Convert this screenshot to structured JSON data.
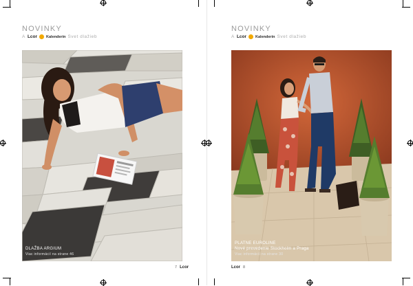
{
  "left_page": {
    "title": "NOVINKY",
    "subtitle_prefix": "A",
    "brand_name": "Lcor",
    "brand_secondary": "Kalenderin",
    "subtitle_suffix": "Svet dlažieb",
    "caption_title": "DLAŽBA ARGIUM",
    "caption_sub": "Viac informácií na strane 46",
    "page_number": "7",
    "footer_brand": "Lcor"
  },
  "right_page": {
    "title": "NOVINKY",
    "subtitle_prefix": "A",
    "brand_name": "Lcor",
    "brand_secondary": "Kalenderin",
    "subtitle_suffix": "Svet dlažieb",
    "caption_title": "PLATNE EUROLINE",
    "caption_line2": "Nové prevedenie Stockholm a Praga",
    "caption_sub": "Viac informácií na strane 30",
    "page_number": "8",
    "footer_brand": "Lcor"
  },
  "colors": {
    "accent_orange": "#f2a900",
    "title_gray": "#9a9a9a",
    "wall_orange": "#c4592f"
  }
}
